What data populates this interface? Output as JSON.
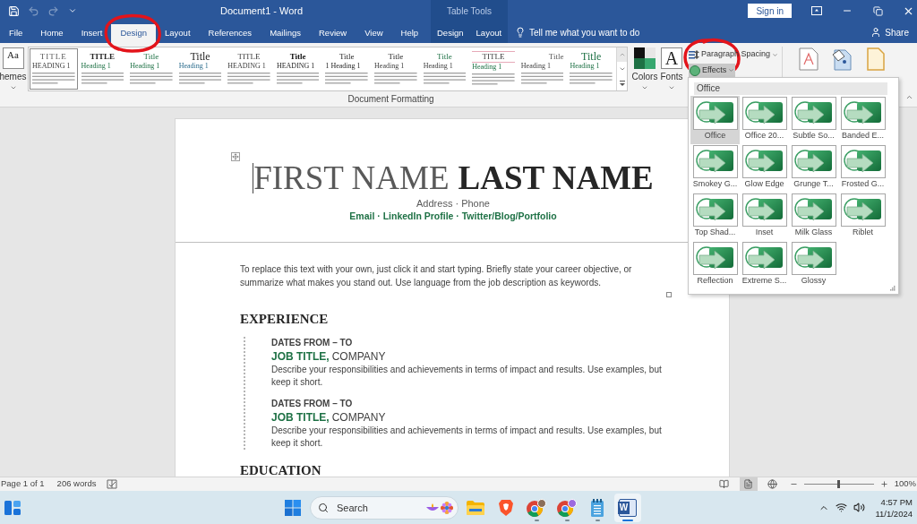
{
  "title_bar": {
    "quick_access": [
      {
        "kind": "save",
        "disabled": false
      },
      {
        "kind": "undo",
        "disabled": true
      },
      {
        "kind": "redo",
        "disabled": true
      },
      {
        "kind": "customize",
        "disabled": false
      }
    ],
    "title": "Document1 - Word",
    "sign_in": "Sign in"
  },
  "tabs": [
    {
      "label": "File",
      "selected": false
    },
    {
      "label": "Home",
      "selected": false
    },
    {
      "label": "Insert",
      "selected": false
    },
    {
      "label": "Design",
      "selected": true
    },
    {
      "label": "Layout",
      "selected": false
    },
    {
      "label": "References",
      "selected": false
    },
    {
      "label": "Mailings",
      "selected": false
    },
    {
      "label": "Review",
      "selected": false
    },
    {
      "label": "View",
      "selected": false
    },
    {
      "label": "Help",
      "selected": false
    }
  ],
  "table_tools": {
    "label": "Table Tools",
    "tabs": [
      {
        "label": "Design",
        "selected": false
      },
      {
        "label": "Layout",
        "selected": false
      }
    ]
  },
  "tell_me": "Tell me what you want to do",
  "share": "Share",
  "ribbon": {
    "themes": {
      "glyph": "Aa",
      "label": "hemes"
    },
    "style_gallery": [
      {
        "title": "TITLE",
        "heading": "HEADING 1",
        "selected": true
      },
      {
        "title": "TITLE",
        "heading": "Heading 1",
        "selected": false
      },
      {
        "title": "Title",
        "heading": "Heading 1",
        "selected": false
      },
      {
        "title": "Title",
        "heading": "Heading 1",
        "selected": false
      },
      {
        "title": "TITLE",
        "heading": "HEADING 1",
        "selected": false
      },
      {
        "title": "Title",
        "heading": "HEADING 1",
        "selected": false
      },
      {
        "title": "Title",
        "heading": "1 Heading 1",
        "selected": false
      },
      {
        "title": "Title",
        "heading": "Heading 1",
        "selected": false
      },
      {
        "title": "Title",
        "heading": "Heading 1",
        "selected": false
      },
      {
        "title": "TITLE",
        "heading": "Heading 1",
        "selected": false
      },
      {
        "title": "Title",
        "heading": "Heading 1",
        "selected": false
      },
      {
        "title": "Title",
        "heading": "Heading 1",
        "selected": false
      }
    ],
    "colors": "Colors",
    "fonts": {
      "glyph": "A",
      "label": "Fonts"
    },
    "paragraph_spacing": "Paragraph Spacing",
    "effects": {
      "label": "Effects",
      "expanded": true
    },
    "group_label": "Document Formatting"
  },
  "effects_menu": {
    "header": "Office",
    "items": [
      {
        "label": "Office",
        "selected": true
      },
      {
        "label": "Office 20...",
        "selected": false
      },
      {
        "label": "Subtle So...",
        "selected": false
      },
      {
        "label": "Banded E...",
        "selected": false
      },
      {
        "label": "Smokey G...",
        "selected": false
      },
      {
        "label": "Glow Edge",
        "selected": false
      },
      {
        "label": "Grunge T...",
        "selected": false
      },
      {
        "label": "Frosted G...",
        "selected": false
      },
      {
        "label": "Top Shad...",
        "selected": false
      },
      {
        "label": "Inset",
        "selected": false
      },
      {
        "label": "Milk Glass",
        "selected": false
      },
      {
        "label": "Riblet",
        "selected": false
      },
      {
        "label": "Reflection",
        "selected": false
      },
      {
        "label": "Extreme S...",
        "selected": false
      },
      {
        "label": "Glossy",
        "selected": false
      }
    ]
  },
  "document": {
    "first_name": "FIRST NAME",
    "last_name": "LAST NAME",
    "contact": "Address · Phone",
    "links": "Email · LinkedIn Profile · Twitter/Blog/Portfolio",
    "objective": "To replace this text with your own, just click it and start typing. Briefly state your career objective, or summarize what makes you stand out. Use language from the job description as keywords.",
    "sections": [
      {
        "heading": "EXPERIENCE",
        "entries": [
          {
            "dates": "DATES FROM – TO",
            "job_title": "JOB TITLE,",
            "company": "COMPANY",
            "description": "Describe your responsibilities and achievements in terms of impact and results. Use examples, but keep it short."
          },
          {
            "dates": "DATES FROM – TO",
            "job_title": "JOB TITLE,",
            "company": "COMPANY",
            "description": "Describe your responsibilities and achievements in terms of impact and results. Use examples, but keep it short."
          }
        ]
      },
      {
        "heading": "EDUCATION"
      }
    ]
  },
  "status_bar": {
    "page": "Page 1 of 1",
    "words": "206 words",
    "views": [
      {
        "kind": "read",
        "selected": false
      },
      {
        "kind": "print",
        "selected": true
      },
      {
        "kind": "web",
        "selected": false
      }
    ],
    "zoom": {
      "level": 0.5,
      "reading": "100%"
    }
  },
  "taskbar": {
    "search": {
      "placeholder": "Search"
    },
    "apps": [
      {
        "kind": "folder",
        "running": false,
        "active": false
      },
      {
        "kind": "shield",
        "running": false,
        "active": false
      },
      {
        "kind": "browser",
        "running": true,
        "active": false
      },
      {
        "kind": "browser-profile",
        "running": true,
        "active": false
      },
      {
        "kind": "notepad",
        "running": true,
        "active": false
      },
      {
        "kind": "word",
        "glyph": "W",
        "running": true,
        "active": true
      }
    ],
    "time": "4:57 PM",
    "date": "11/1/2024"
  }
}
